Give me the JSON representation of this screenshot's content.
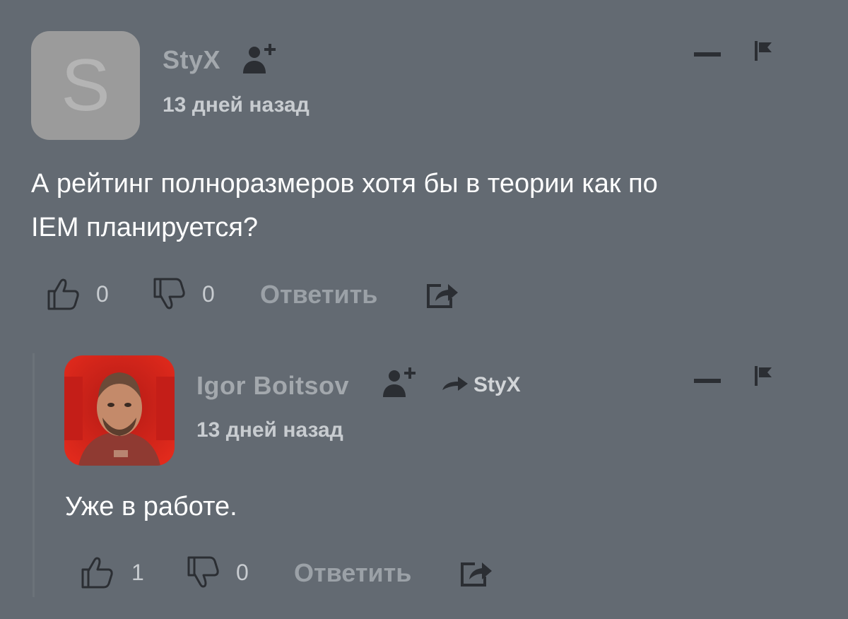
{
  "comments": [
    {
      "author": "StyX",
      "avatar_letter": "S",
      "time": "13 дней назад",
      "text_line1": "А рейтинг полноразмеров хотя бы в теории как по",
      "text_line2": "IEM планируется?",
      "likes": "0",
      "dislikes": "0",
      "reply_label": "Ответить"
    },
    {
      "author": "Igor Boitsov",
      "reply_to": "StyX",
      "time": "13 дней назад",
      "text": "Уже в работе.",
      "likes": "1",
      "dislikes": "0",
      "reply_label": "Ответить"
    }
  ],
  "colors": {
    "background": "#636a72",
    "icon": "#2b2e33",
    "accent_text": "#c8ccd0"
  }
}
